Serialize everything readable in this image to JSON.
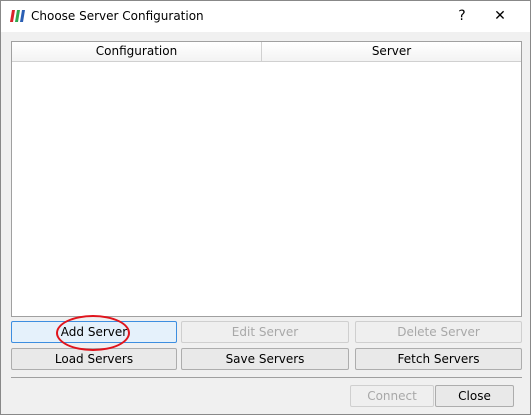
{
  "window": {
    "title": "Choose Server Configuration",
    "help_label": "?",
    "close_label": "✕"
  },
  "table": {
    "columns": [
      "Configuration",
      "Server"
    ],
    "rows": []
  },
  "buttons": {
    "add": "Add Server",
    "edit": "Edit Server",
    "delete": "Delete Server",
    "load": "Load Servers",
    "save": "Save Servers",
    "fetch": "Fetch Servers",
    "connect": "Connect",
    "close": "Close"
  },
  "colors": {
    "highlight_ring": "#e0141c",
    "focus_border": "#3d8ee0"
  },
  "icons": {
    "app": "paraview-logo-icon"
  }
}
